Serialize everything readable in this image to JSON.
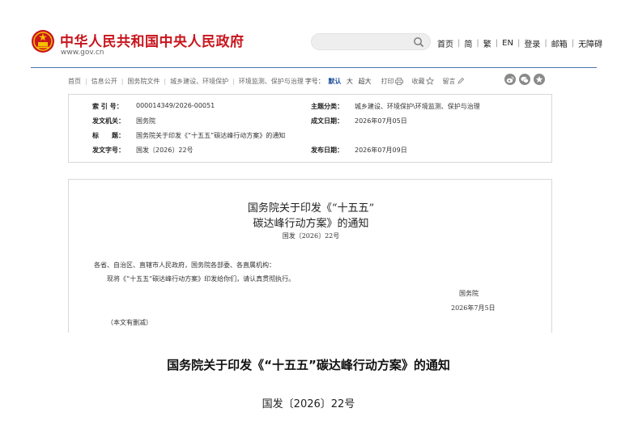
{
  "header": {
    "site_title": "中华人民共和国中央人民政府",
    "site_url": "www.gov.cn",
    "search_placeholder": "",
    "nav": [
      "首页",
      "简",
      "繁",
      "EN",
      "登录",
      "邮箱",
      "无障碍"
    ]
  },
  "breadcrumb": {
    "items": [
      "首页",
      "信息公开",
      "国务院文件",
      "城乡建设、环境保护",
      "环境监测、保护与治理"
    ],
    "font_size_label": "字号：",
    "font_sizes": [
      "默认",
      "大",
      "超大"
    ],
    "active_font_size": "默认",
    "print": "打印",
    "favorite": "收藏",
    "comment": "留言"
  },
  "meta": {
    "index_label": "索 引 号：",
    "index_value": "000014349/2026-00051",
    "topic_label": "主题分类：",
    "topic_value": "城乡建设、环境保护\\环境监测、保护与治理",
    "issuer_label": "发文机关：",
    "issuer_value": "国务院",
    "written_label": "成文日期：",
    "written_value": "2026年07月05日",
    "title_label": "标　　题：",
    "title_value": "国务院关于印发《“十五五”碳达峰行动方案》的通知",
    "docno_label": "发文字号：",
    "docno_value": "国发〔2026〕22号",
    "published_label": "发布日期：",
    "published_value": "2026年07月09日"
  },
  "document": {
    "title_line1": "国务院关于印发《“十五五”",
    "title_line2": "碳达峰行动方案》的通知",
    "doc_no": "国发〔2026〕22号",
    "addressee": "各省、自治区、直辖市人民政府，国务院各部委、各直属机构：",
    "body": "现将《“十五五”碳达峰行动方案》印发给你们，请认真贯彻执行。",
    "signature": "国务院",
    "date": "2026年7月5日",
    "note": "（本文有删减）"
  },
  "article": {
    "title": "国务院关于印发《“十五五”碳达峰行动方案》的通知",
    "doc_no": "国发〔2026〕22号"
  },
  "colors": {
    "brand_red": "#c8161d",
    "gold": "#f5c000",
    "rule_blue": "#4a74b0",
    "active_blue": "#1a4c9c"
  },
  "icons": [
    "national-emblem-icon",
    "search-icon",
    "printer-icon",
    "star-icon",
    "pencil-icon",
    "weibo-icon",
    "wechat-icon",
    "favorite-circle-icon"
  ]
}
